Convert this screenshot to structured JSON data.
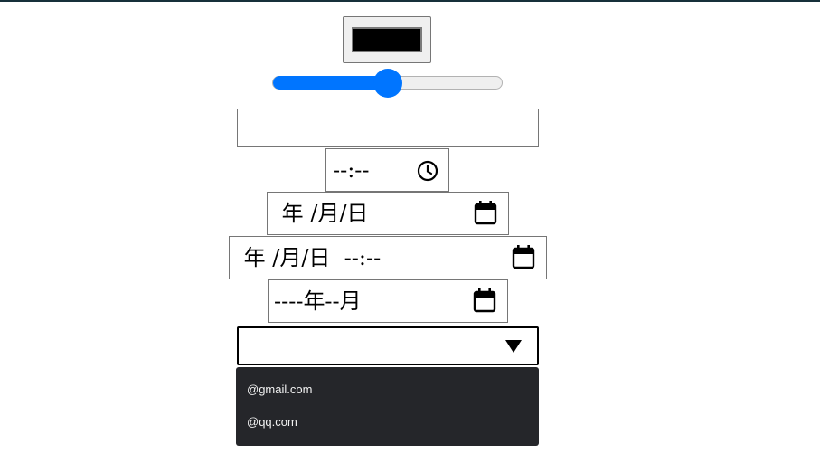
{
  "color_picker": {
    "value": "#000000"
  },
  "slider": {
    "value_percent": 50
  },
  "text_input": {
    "value": ""
  },
  "time_input": {
    "display": "--:--",
    "icon": "clock-icon"
  },
  "date_input": {
    "display": " 年 /月/日",
    "icon": "calendar-icon"
  },
  "datetime_input": {
    "display": " 年 /月/日  --:--",
    "icon": "calendar-icon"
  },
  "month_input": {
    "display": "----年--月",
    "icon": "calendar-icon"
  },
  "email_select": {
    "value": "",
    "icon": "dropdown-arrow-icon",
    "options": [
      "@gmail.com",
      "@qq.com"
    ]
  }
}
